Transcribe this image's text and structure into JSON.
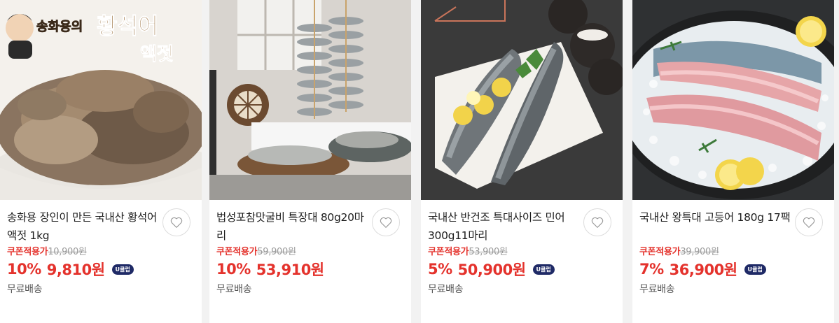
{
  "products": [
    {
      "image_text": {
        "brand": "송화용의",
        "name": "황석어",
        "sub": "액젓"
      },
      "title": "송화용 장인이 만든 국내산 황석어액젓 1kg",
      "coupon_label": "쿠폰적용가",
      "original_price": "10,900원",
      "discount": "10%",
      "price": "9,810원",
      "badge": "U클럽",
      "shipping": "무료배송"
    },
    {
      "title": "법성포참맛굴비 특장대 80g20마리",
      "coupon_label": "쿠폰적용가",
      "original_price": "59,900원",
      "discount": "10%",
      "price": "53,910원",
      "shipping": "무료배송"
    },
    {
      "title": "국내산 반건조 특대사이즈 민어 300g11마리",
      "coupon_label": "쿠폰적용가",
      "original_price": "53,900원",
      "discount": "5%",
      "price": "50,900원",
      "badge": "U클럽",
      "shipping": "무료배송"
    },
    {
      "title": "국내산 왕특대 고등어 180g 17팩",
      "coupon_label": "쿠폰적용가",
      "original_price": "39,900원",
      "discount": "7%",
      "price": "36,900원",
      "badge": "U클럽",
      "shipping": "무료배송"
    }
  ],
  "colors": {
    "sale_red": "#e4322c",
    "uclub_navy": "#1f2a66",
    "page_bg": "#f2f2f2"
  },
  "icons": [
    "heart-icon"
  ]
}
